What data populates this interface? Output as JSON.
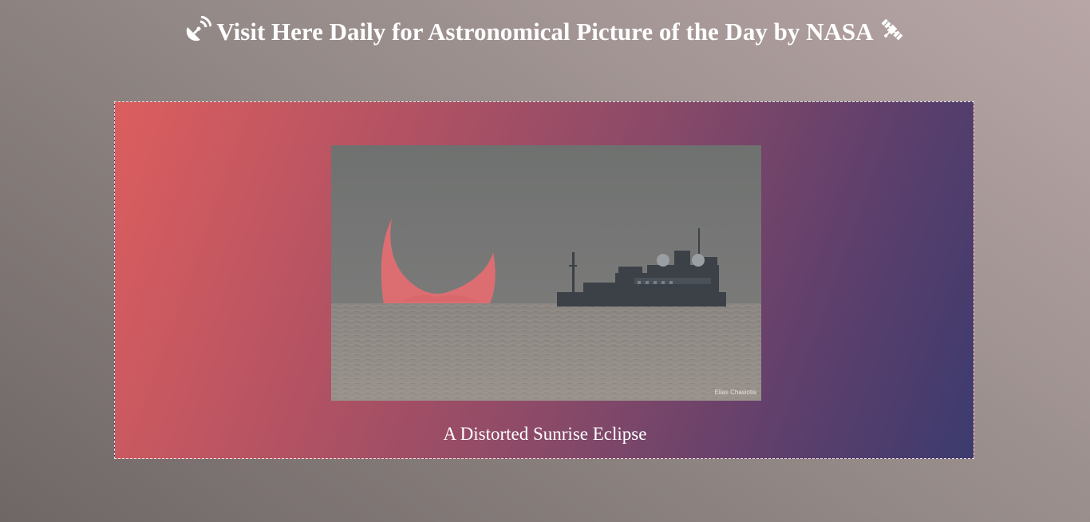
{
  "header": {
    "title": "Visit Here Daily for Astronomical Picture of the Day by NASA",
    "left_icon": "satellite-dish-icon",
    "right_icon": "satellite-icon"
  },
  "apod": {
    "caption": "A Distorted Sunrise Eclipse",
    "photo_credit": "Elias Chasiotis",
    "image_description_icon": "photo"
  },
  "colors": {
    "text": "#ffffff",
    "card_gradient_start": "#dc5e5e",
    "card_gradient_end": "#3c3b6e",
    "sun_color": "#e86b72",
    "sea_color": "#8c8580",
    "sky_color": "#747474"
  }
}
